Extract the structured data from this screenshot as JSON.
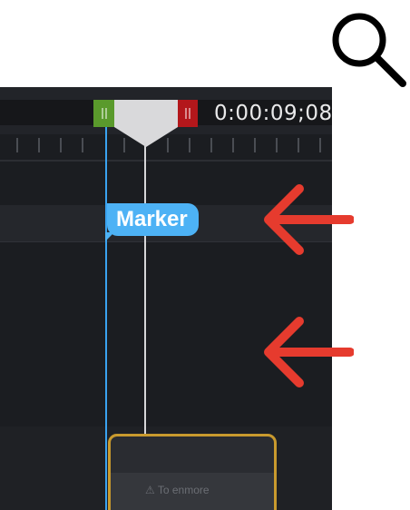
{
  "timeline": {
    "timecode": "0:00:09;08",
    "marker_label": "Marker",
    "clip_label": "⚠ To enmore"
  },
  "icons": {
    "search": "search-icon",
    "arrows": "arrow-left-icon"
  },
  "colors": {
    "marker": "#4db2f5",
    "in_point": "#5a9a2c",
    "out_point": "#b3171b",
    "clip_border": "#c99a2e",
    "annotation_arrow": "#e63b2e"
  }
}
